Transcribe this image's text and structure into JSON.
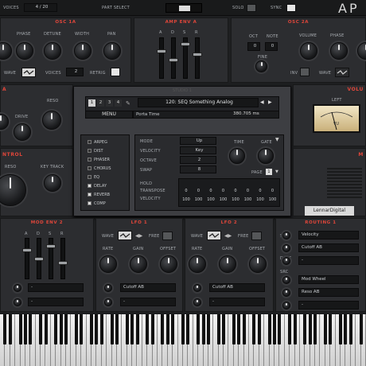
{
  "topbar": {
    "voices_label": "VOICES",
    "voices_value": "4 / 20",
    "part_select_label": "PART SELECT",
    "solo_label": "SOLO",
    "sync_label": "SYNC",
    "brand": "AP"
  },
  "osc1a": {
    "title": "OSC 1A",
    "knobs": [
      "PHASE",
      "DETUNE",
      "WIDTH",
      "PAN"
    ],
    "wave_label": "WAVE",
    "voices_label": "VOICES",
    "voices_value": "2",
    "retrig_label": "RETRIG"
  },
  "ampenv": {
    "title": "AMP ENV A",
    "faders": [
      "A",
      "D",
      "S",
      "R"
    ],
    "slider_levels": [
      0.7,
      0.45,
      0.9,
      0.6
    ]
  },
  "osc2a": {
    "title": "OSC 2A",
    "oct_label": "OCT",
    "oct_value": "0",
    "note_label": "NOTE",
    "note_value": "0",
    "fine_label": "FINE",
    "knobs": [
      "VOLUME",
      "PHASE"
    ],
    "inv_label": "INV",
    "wave_label": "WAVE"
  },
  "filter": {
    "reso_label": "RESO",
    "drive_label": "DRIVE"
  },
  "control": {
    "title": "NTROL",
    "reso_label": "RESO",
    "keytrack_label": "KEY TRACK"
  },
  "volume": {
    "title": "VOLU",
    "left_label": "LEFT",
    "vu_label": "VU"
  },
  "studio": {
    "title": "STUDIO 1",
    "tabs": [
      "1",
      "2",
      "3",
      "4"
    ],
    "preset_name": "120: SEQ Something Analog",
    "menu_label": "MENU",
    "param_name": "Porta Time",
    "param_value": "380.705 ms",
    "fx": [
      {
        "name": "ARPEG",
        "on": false
      },
      {
        "name": "DIST",
        "on": false
      },
      {
        "name": "PHASER",
        "on": false
      },
      {
        "name": "CHORUS",
        "on": false
      },
      {
        "name": "EQ",
        "on": false
      },
      {
        "name": "DELAY",
        "on": true
      },
      {
        "name": "REVERB",
        "on": true
      },
      {
        "name": "COMP",
        "on": true
      }
    ],
    "arp": {
      "mode_label": "MODE",
      "mode_value": "Up",
      "velocity_label": "VELOCITY",
      "velocity_value": "Key",
      "octave_label": "OCTAVE",
      "octave_value": "2",
      "swap_label": "SWAP",
      "swap_value": "8",
      "time_label": "TIME",
      "gate_label": "GATE",
      "page_label": "PAGE",
      "page_value": "1",
      "hold_label": "HOLD",
      "transpose_label": "TRANSPOSE",
      "transpose_values": [
        "0",
        "0",
        "0",
        "0",
        "0",
        "0",
        "0",
        "0"
      ],
      "vel_label": "VELOCITY",
      "velocity_values": [
        "100",
        "100",
        "100",
        "100",
        "100",
        "100",
        "100",
        "100"
      ]
    }
  },
  "right": {
    "brand": "LennarDigital",
    "m_label": "M"
  },
  "modenv2": {
    "title": "MOD ENV 2",
    "faders": [
      "A",
      "D",
      "S",
      "R"
    ],
    "slider_levels": [
      0.75,
      0.5,
      0.85,
      0.4
    ],
    "fields": [
      "-",
      "-"
    ]
  },
  "lfo1": {
    "title": "LFO 1",
    "wave_label": "WAVE",
    "free_label": "FREE",
    "knobs": [
      "RATE",
      "GAIN",
      "OFFSET"
    ],
    "dest1": "Cutoff AB",
    "dest2": "-"
  },
  "lfo2": {
    "title": "LFO 2",
    "wave_label": "WAVE",
    "free_label": "FREE",
    "knobs": [
      "RATE",
      "GAIN",
      "OFFSET"
    ],
    "dest1": "Cutoff AB",
    "dest2": "-"
  },
  "routing1": {
    "title": "ROUTING 1",
    "src_label": "SRC",
    "dest_label": "DEST",
    "src_label2": "SRC",
    "routes": [
      "Velocity",
      "Cutoff AB",
      "-",
      "Mod Wheel",
      "Reso AB",
      "-"
    ]
  }
}
